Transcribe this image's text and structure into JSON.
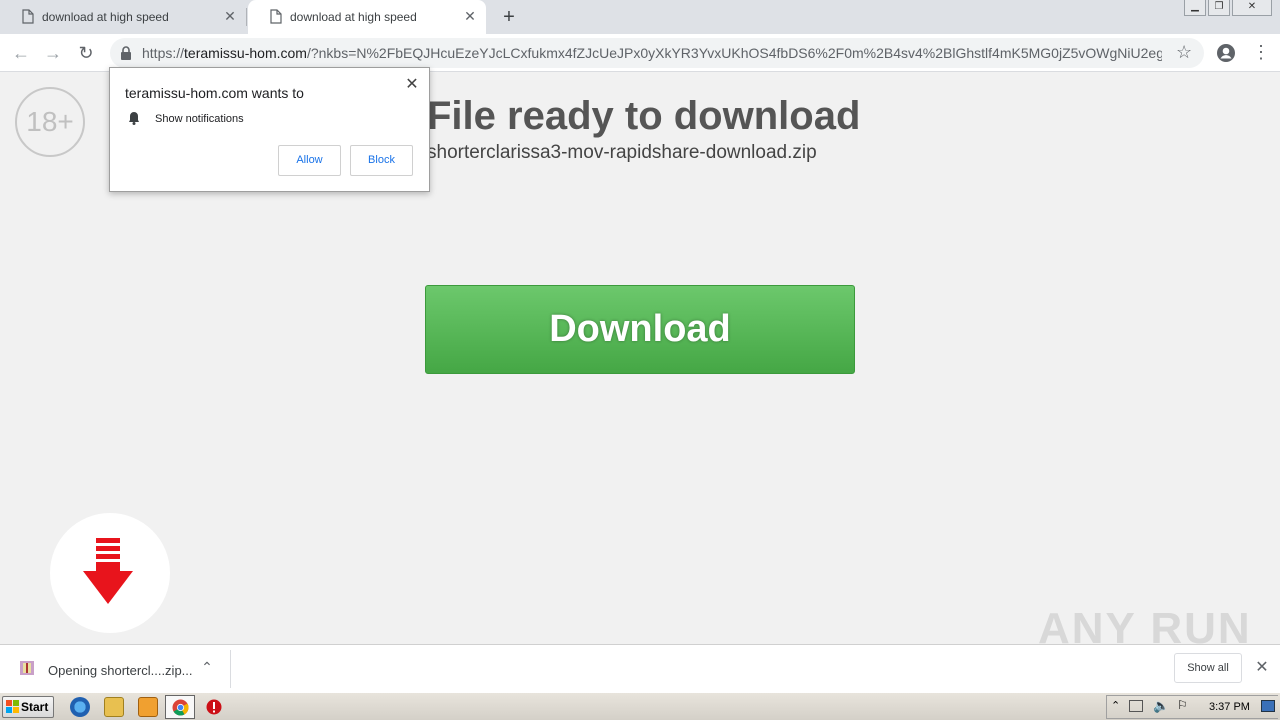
{
  "tabs": [
    {
      "title": "download at high speed",
      "active": false
    },
    {
      "title": "download at high speed",
      "active": true
    }
  ],
  "toolbar": {
    "url_scheme": "https://",
    "url_host": "teramissu-hom.com",
    "url_rest": "/?nkbs=N%2FbEQJHcuEzeYJcLCxfukmx4fZJcUeJPx0yXkYR3YvxUKhOS4fbDS6%2F0m%2B4sv4%2BlGhstlf4mK5MG0jZ5vOWgNiU2egG..."
  },
  "page": {
    "age_badge": "18+",
    "title": "File ready to download",
    "filename": "shorterclarissa3-mov-rapidshare-download.zip",
    "download_label": "Download"
  },
  "notification": {
    "title": "teramissu-hom.com wants to",
    "permission": "Show notifications",
    "allow_label": "Allow",
    "block_label": "Block"
  },
  "download_shelf": {
    "item_label": "Opening shortercl....zip...",
    "show_all_label": "Show all"
  },
  "watermark": "ANY RUN",
  "taskbar": {
    "start_label": "Start",
    "clock": "3:37 PM"
  },
  "colors": {
    "download_button": "#4cae4c",
    "arrow_red": "#e8141c",
    "link_blue": "#1a73e8"
  }
}
